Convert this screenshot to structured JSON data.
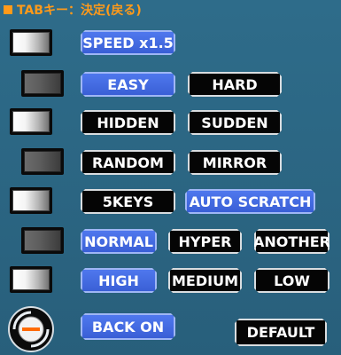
{
  "header": {
    "text": "TABキー：決定(戻る)"
  },
  "colors": {
    "selected": "#3f66de",
    "unselected": "#050505",
    "background": "#2c6785",
    "header": "#ff9a1a"
  },
  "icons": {
    "knob": "turntable-minus-icon",
    "lamp": "toggle-lamp-icon"
  },
  "options": {
    "speed": {
      "label": "SPEED x1.5",
      "lamp": "on"
    },
    "difficulty": {
      "lamp": "off",
      "easy": "EASY",
      "hard": "HARD"
    },
    "hidden_sudden": {
      "lamp": "on",
      "hidden": "HIDDEN",
      "sudden": "SUDDEN"
    },
    "random_mirror": {
      "lamp": "off",
      "random": "RANDOM",
      "mirror": "MIRROR"
    },
    "keys": {
      "lamp": "on",
      "fivekeys": "5KEYS",
      "auto_scratch": "AUTO SCRATCH"
    },
    "gauge": {
      "lamp": "off",
      "normal": "NORMAL",
      "hyper": "HYPER",
      "another": "ANOTHER"
    },
    "quality": {
      "lamp": "on",
      "high": "HIGH",
      "medium": "MEDIUM",
      "low": "LOW"
    },
    "back": {
      "label": "BACK ON"
    },
    "default": {
      "label": "DEFAULT"
    }
  }
}
